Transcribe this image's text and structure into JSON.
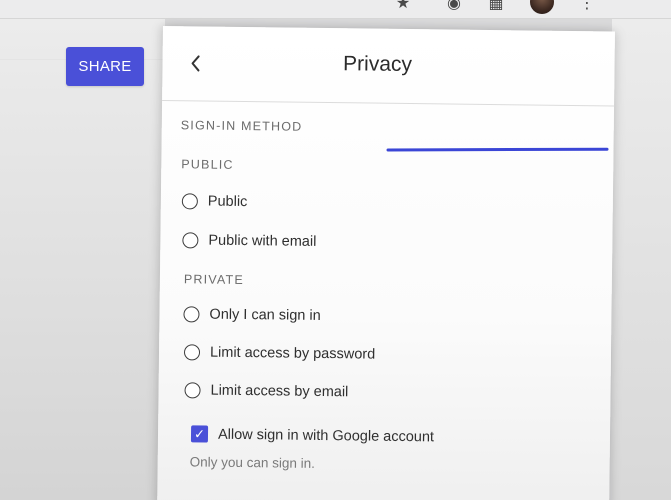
{
  "toolbar": {
    "icons": [
      "star-icon",
      "extension-icon",
      "puzzle-icon",
      "profile-avatar",
      "more-icon"
    ]
  },
  "page": {
    "share_label": "SHARE"
  },
  "panel": {
    "title": "Privacy",
    "back_icon": "chevron-left-icon",
    "sign_in_method_label": "SIGN-IN METHOD",
    "public_label": "PUBLIC",
    "public_options": [
      {
        "label": "Public",
        "selected": false
      },
      {
        "label": "Public with email",
        "selected": false
      }
    ],
    "private_label": "PRIVATE",
    "private_options": [
      {
        "label": "Only I can sign in",
        "selected": false
      },
      {
        "label": "Limit access by password",
        "selected": false
      },
      {
        "label": "Limit access by email",
        "selected": false
      }
    ],
    "google_option": {
      "label": "Allow sign in with Google account",
      "checked": true
    },
    "helper_text": "Only you can sign in."
  },
  "colors": {
    "accent": "#4a50d8",
    "highlight_line": "#3b46d6"
  }
}
